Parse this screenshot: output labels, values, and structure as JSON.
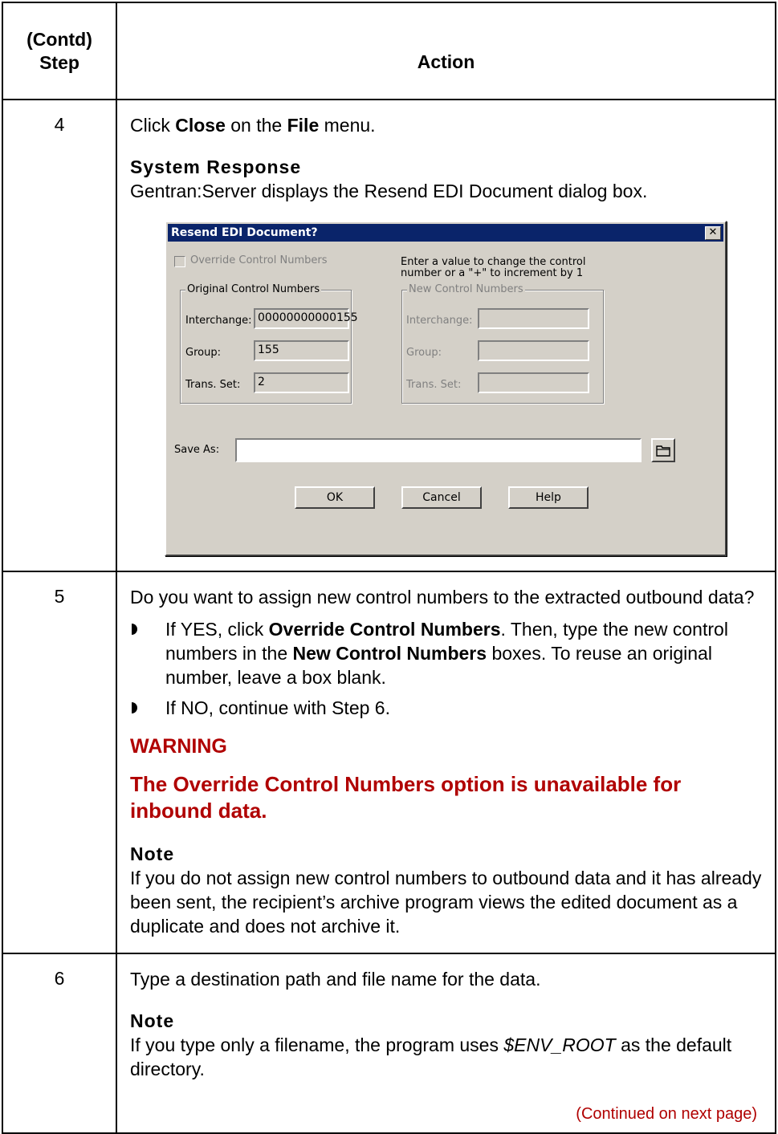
{
  "header": {
    "step_line1": "(Contd)",
    "step_line2": "Step",
    "action": "Action"
  },
  "step4": {
    "number": "4",
    "line_pre": "Click ",
    "line_close": "Close",
    "line_mid": " on the ",
    "line_file": "File",
    "line_post": " menu.",
    "response_title": "System Response",
    "response_text": "Gentran:Server displays the Resend EDI Document dialog box."
  },
  "dialog": {
    "title": "Resend EDI Document?",
    "close_glyph": "✕",
    "override_label": "Override Control Numbers",
    "hint_line1": "Enter a value to change the control",
    "hint_line2": "number or a \"+\" to increment by 1",
    "original_group": "Original Control Numbers",
    "new_group": "New Control Numbers",
    "interchange_label": "Interchange:",
    "group_label": "Group:",
    "transset_label": "Trans. Set:",
    "orig_interchange": "00000000000155",
    "orig_group": "155",
    "orig_transset": "2",
    "new_interchange": "",
    "new_group_value": "",
    "new_transset": "",
    "save_as_label": "Save As:",
    "save_as_value": "",
    "ok": "OK",
    "cancel": "Cancel",
    "help": "Help",
    "folder_icon": "folder-icon"
  },
  "step5": {
    "number": "5",
    "question": "Do you want to assign new control numbers to the extracted outbound data?",
    "yes_pre": "If YES, click ",
    "yes_b1": "Override Control Numbers",
    "yes_mid": ". Then, type the new control numbers in the ",
    "yes_b2": "New Control Numbers",
    "yes_post": " boxes. To reuse an original number, leave a box blank.",
    "no_text": "If NO, continue with Step 6.",
    "warning_title": "WARNING",
    "warning_text": "The Override Control Numbers option is unavailable for inbound data.",
    "note_title": "Note",
    "note_text": "If you do not assign new control numbers to outbound data and it has already been sent, the recipient’s archive program views the edited document as a duplicate and does not archive it."
  },
  "step6": {
    "number": "6",
    "text": "Type a destination path and file name for the data.",
    "note_title": "Note",
    "note_pre": "If you type only a filename, the program uses ",
    "note_var": "$ENV_ROOT",
    "note_post": " as the default directory.",
    "continued": "(Continued on next page)"
  }
}
